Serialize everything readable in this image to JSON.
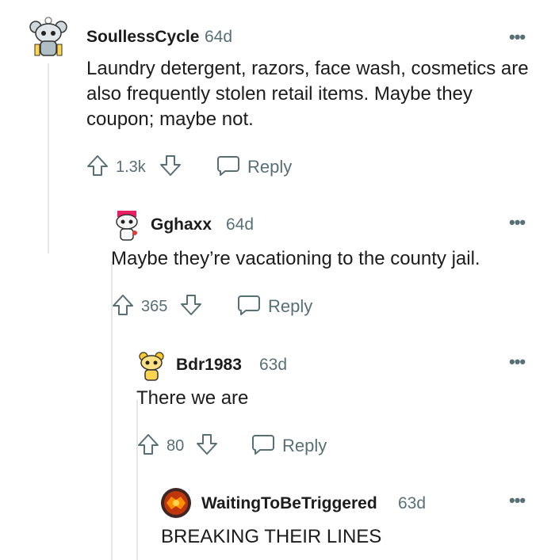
{
  "comments": [
    {
      "username": "SoullessCycle",
      "age": "64d",
      "body": "Laundry detergent, razors, face wash, cosmetics are also frequently stolen retail items. Maybe they coupon; maybe not.",
      "score": "1.3k",
      "reply_label": "Reply",
      "more_label": "•••",
      "avatar_icon": "snoo-avatar-icon"
    },
    {
      "username": "Gghaxx",
      "age": "64d",
      "body": "Maybe they’re vacationing to the county jail.",
      "score": "365",
      "reply_label": "Reply",
      "more_label": "•••",
      "avatar_icon": "snoo-avatar-icon"
    },
    {
      "username": "Bdr1983",
      "age": "63d",
      "body": "There we are",
      "score": "80",
      "reply_label": "Reply",
      "more_label": "•••",
      "avatar_icon": "snoo-avatar-icon"
    },
    {
      "username": "WaitingToBeTriggered",
      "age": "63d",
      "body": "BREAKING THEIR LINES",
      "more_label": "•••",
      "avatar_icon": "round-badge-avatar-icon"
    }
  ],
  "colors": {
    "text": "#1c1c1c",
    "meta": "#576f76",
    "thread_line": "#e6e6e6"
  }
}
